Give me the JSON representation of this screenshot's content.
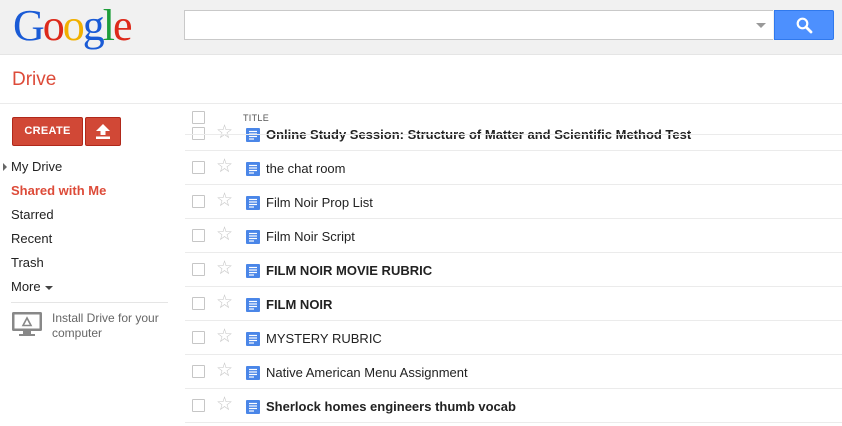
{
  "logo": {
    "letters": [
      "G",
      "o",
      "o",
      "g",
      "l",
      "e"
    ],
    "colors": [
      "#1a5bd6",
      "#dd2a1b",
      "#f1b000",
      "#1a5bd6",
      "#1e9e3a",
      "#dd2a1b"
    ]
  },
  "search": {
    "value": "",
    "placeholder": ""
  },
  "app": {
    "title": "Drive"
  },
  "actions": {
    "create_label": "CREATE"
  },
  "nav": {
    "items": [
      {
        "label": "My Drive"
      },
      {
        "label": "Shared with Me"
      },
      {
        "label": "Starred"
      },
      {
        "label": "Recent"
      },
      {
        "label": "Trash"
      },
      {
        "label": "More"
      }
    ],
    "active_index": 1
  },
  "install": {
    "label": "Install Drive for your computer"
  },
  "list": {
    "column_title": "TITLE",
    "files": [
      {
        "title": "Online Study Session: Structure of Matter and Scientific Method Test",
        "bold": true
      },
      {
        "title": "the chat room",
        "bold": false
      },
      {
        "title": "Film Noir Prop List",
        "bold": false
      },
      {
        "title": "Film Noir Script",
        "bold": false
      },
      {
        "title": "FILM NOIR MOVIE RUBRIC",
        "bold": true
      },
      {
        "title": "FILM NOIR",
        "bold": true
      },
      {
        "title": "MYSTERY RUBRIC",
        "bold": false
      },
      {
        "title": "Native American Menu Assignment",
        "bold": false
      },
      {
        "title": "Sherlock homes engineers thumb vocab",
        "bold": true
      }
    ]
  },
  "colors": {
    "accent_red": "#dd4b39",
    "create_red": "#d14836",
    "search_blue": "#4d90fe",
    "doc_blue": "#4a86e8"
  },
  "icons": {
    "search": "search-icon",
    "upload": "upload-icon",
    "star": "star-icon",
    "document": "document-icon",
    "monitor": "drive-desktop-icon"
  }
}
